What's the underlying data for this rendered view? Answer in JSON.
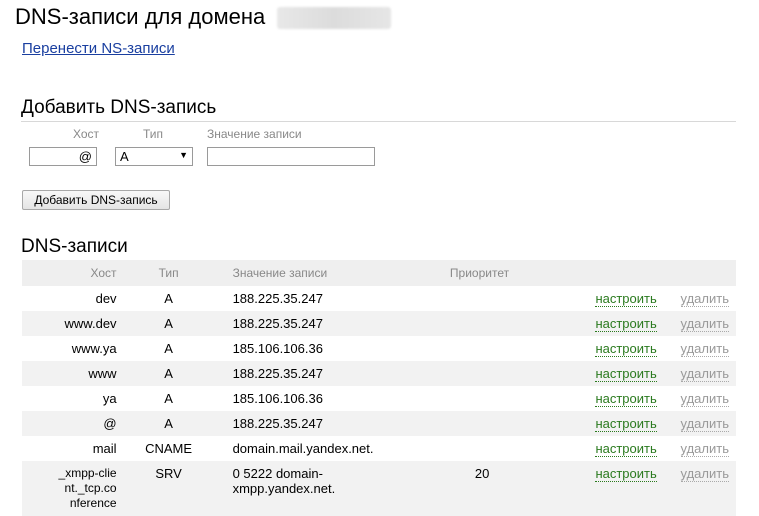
{
  "header": {
    "title": "DNS-записи для домена",
    "ns_link": "Перенести NS-записи"
  },
  "add_form": {
    "heading": "Добавить DNS-запись",
    "host_label": "Хост",
    "type_label": "Тип",
    "value_label": "Значение записи",
    "host_value": "@",
    "type_value": "A",
    "value_value": "",
    "submit_label": "Добавить DNS-запись"
  },
  "records": {
    "heading": "DNS-записи",
    "columns": [
      "Хост",
      "Тип",
      "Значение записи",
      "Приоритет"
    ],
    "edit_label": "настроить",
    "delete_label": "удалить",
    "rows": [
      {
        "host": "dev",
        "type": "A",
        "value": "188.225.35.247",
        "priority": ""
      },
      {
        "host": "www.dev",
        "type": "A",
        "value": "188.225.35.247",
        "priority": ""
      },
      {
        "host": "www.ya",
        "type": "A",
        "value": "185.106.106.36",
        "priority": ""
      },
      {
        "host": "www",
        "type": "A",
        "value": "188.225.35.247",
        "priority": ""
      },
      {
        "host": "ya",
        "type": "A",
        "value": "185.106.106.36",
        "priority": ""
      },
      {
        "host": "@",
        "type": "A",
        "value": "188.225.35.247",
        "priority": ""
      },
      {
        "host": "mail",
        "type": "CNAME",
        "value": "domain.mail.yandex.net.",
        "priority": ""
      },
      {
        "host": "_xmpp-clie\nnt._tcp.co\nnference",
        "type": "SRV",
        "value": "0 5222 domain-\nxmpp.yandex.net.",
        "priority": "20"
      }
    ]
  },
  "colors": {
    "link": "#1a3fa0",
    "edit": "#2a7a1e",
    "delete": "#999999",
    "row_alt": "#f2f2f2"
  }
}
